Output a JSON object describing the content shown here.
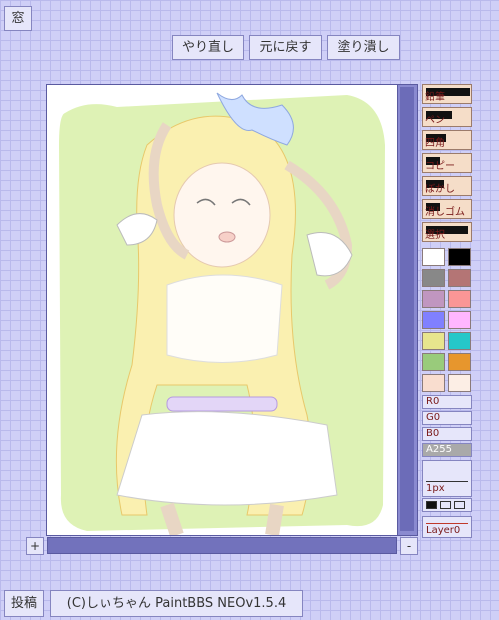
{
  "header": {
    "window_label": "窓",
    "redo_label": "やり直し",
    "undo_label": "元に戻す",
    "fill_label": "塗り潰し"
  },
  "tools": [
    {
      "name": "pencil",
      "label": "鉛筆"
    },
    {
      "name": "pen",
      "label": "ペン"
    },
    {
      "name": "rect",
      "label": "四角"
    },
    {
      "name": "copy",
      "label": "コピー"
    },
    {
      "name": "blur",
      "label": "ぼかし"
    },
    {
      "name": "eraser",
      "label": "消しゴム"
    },
    {
      "name": "select",
      "label": "選択"
    }
  ],
  "palette": [
    "#ffffff",
    "#000000",
    "#888888",
    "#b47575",
    "#c096c0",
    "#fa9696",
    "#8080ff",
    "#ffb6ff",
    "#e7e58d",
    "#25c7c9",
    "#99cb7b",
    "#e7962d",
    "#f9ddcf",
    "#fceee5"
  ],
  "sliders": {
    "r": "R0",
    "g": "G0",
    "b": "B0",
    "a": "A255"
  },
  "pen_size": "1px",
  "layer": "Layer0",
  "zoom": {
    "plus": "+",
    "minus": "-"
  },
  "footer": {
    "post_label": "投稿",
    "credit_label": "(C)しぃちゃん PaintBBS NEOv1.5.4"
  }
}
